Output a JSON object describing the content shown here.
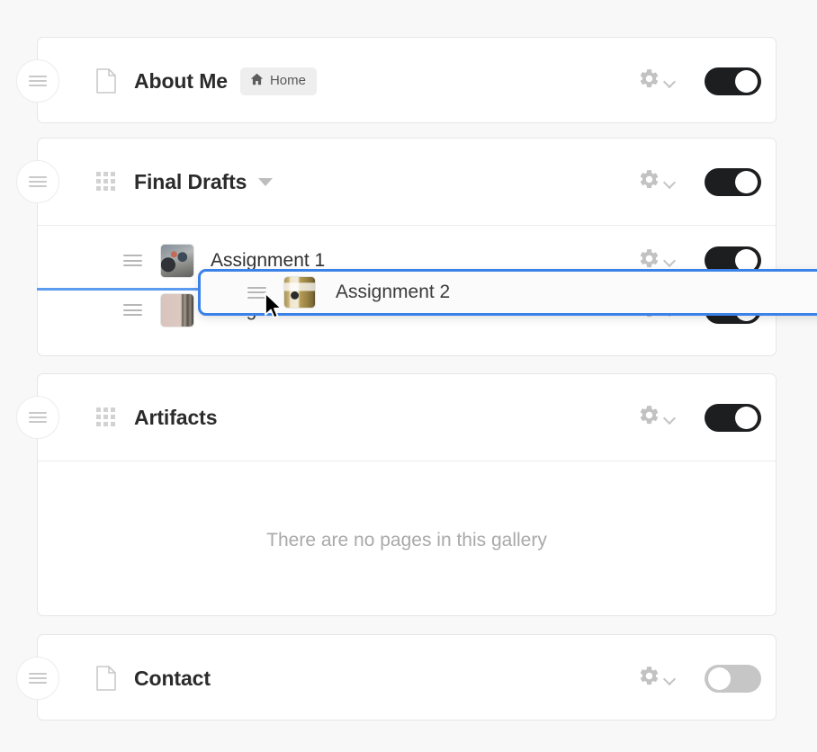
{
  "theme": {
    "page_background": "#f8f8f8",
    "card_background": "#ffffff",
    "card_border": "#e6e6e6",
    "accent_blue": "#3b82e8",
    "drop_line_blue": "#5b9bf0",
    "toggle_on": "#1d1e20",
    "toggle_off": "#c6c6c6",
    "title_color": "#2b2b2b",
    "muted_text": "#a9a9a9"
  },
  "items": [
    {
      "id": "about-me",
      "kind": "page",
      "type_icon": "page-document-icon",
      "title": "About Me",
      "badge": {
        "label": "Home",
        "icon": "home-icon"
      },
      "has_caret": false,
      "gear_icon": "gear-icon",
      "chevron_icon": "chevron-down-icon",
      "toggle": {
        "state": "on",
        "label": "Visible"
      }
    },
    {
      "id": "final-drafts",
      "kind": "gallery",
      "type_icon": "gallery-grid-icon",
      "title": "Final Drafts",
      "badge": null,
      "has_caret": true,
      "caret_icon": "caret-down-icon",
      "gear_icon": "gear-icon",
      "chevron_icon": "chevron-down-icon",
      "toggle": {
        "state": "on",
        "label": "Visible"
      },
      "pages": [
        {
          "title": "Assignment 1",
          "thumbnail": "workshop-photo-thumbnail",
          "handle_icon": "drag-handle-icon",
          "gear_icon": "gear-icon",
          "toggle": {
            "state": "on"
          }
        },
        {
          "title": "Assignment 3",
          "thumbnail": "pink-book-photo-thumbnail",
          "handle_icon": "drag-handle-icon",
          "gear_icon": "gear-icon",
          "toggle": {
            "state": "on"
          }
        }
      ]
    },
    {
      "id": "artifacts",
      "kind": "gallery",
      "type_icon": "gallery-grid-icon",
      "title": "Artifacts",
      "badge": null,
      "has_caret": false,
      "gear_icon": "gear-icon",
      "chevron_icon": "chevron-down-icon",
      "toggle": {
        "state": "on",
        "label": "Visible"
      },
      "empty_message": "There are no pages in this gallery",
      "pages": []
    },
    {
      "id": "contact",
      "kind": "page",
      "type_icon": "page-document-icon",
      "title": "Contact",
      "badge": null,
      "has_caret": false,
      "gear_icon": "gear-icon",
      "chevron_icon": "chevron-down-icon",
      "toggle": {
        "state": "off",
        "label": "Hidden"
      }
    }
  ],
  "drag": {
    "active": true,
    "title": "Assignment 2",
    "thumbnail": "olive-journal-photo-thumbnail",
    "handle_icon": "drag-handle-icon",
    "cursor_icon": "arrow-cursor-icon"
  }
}
